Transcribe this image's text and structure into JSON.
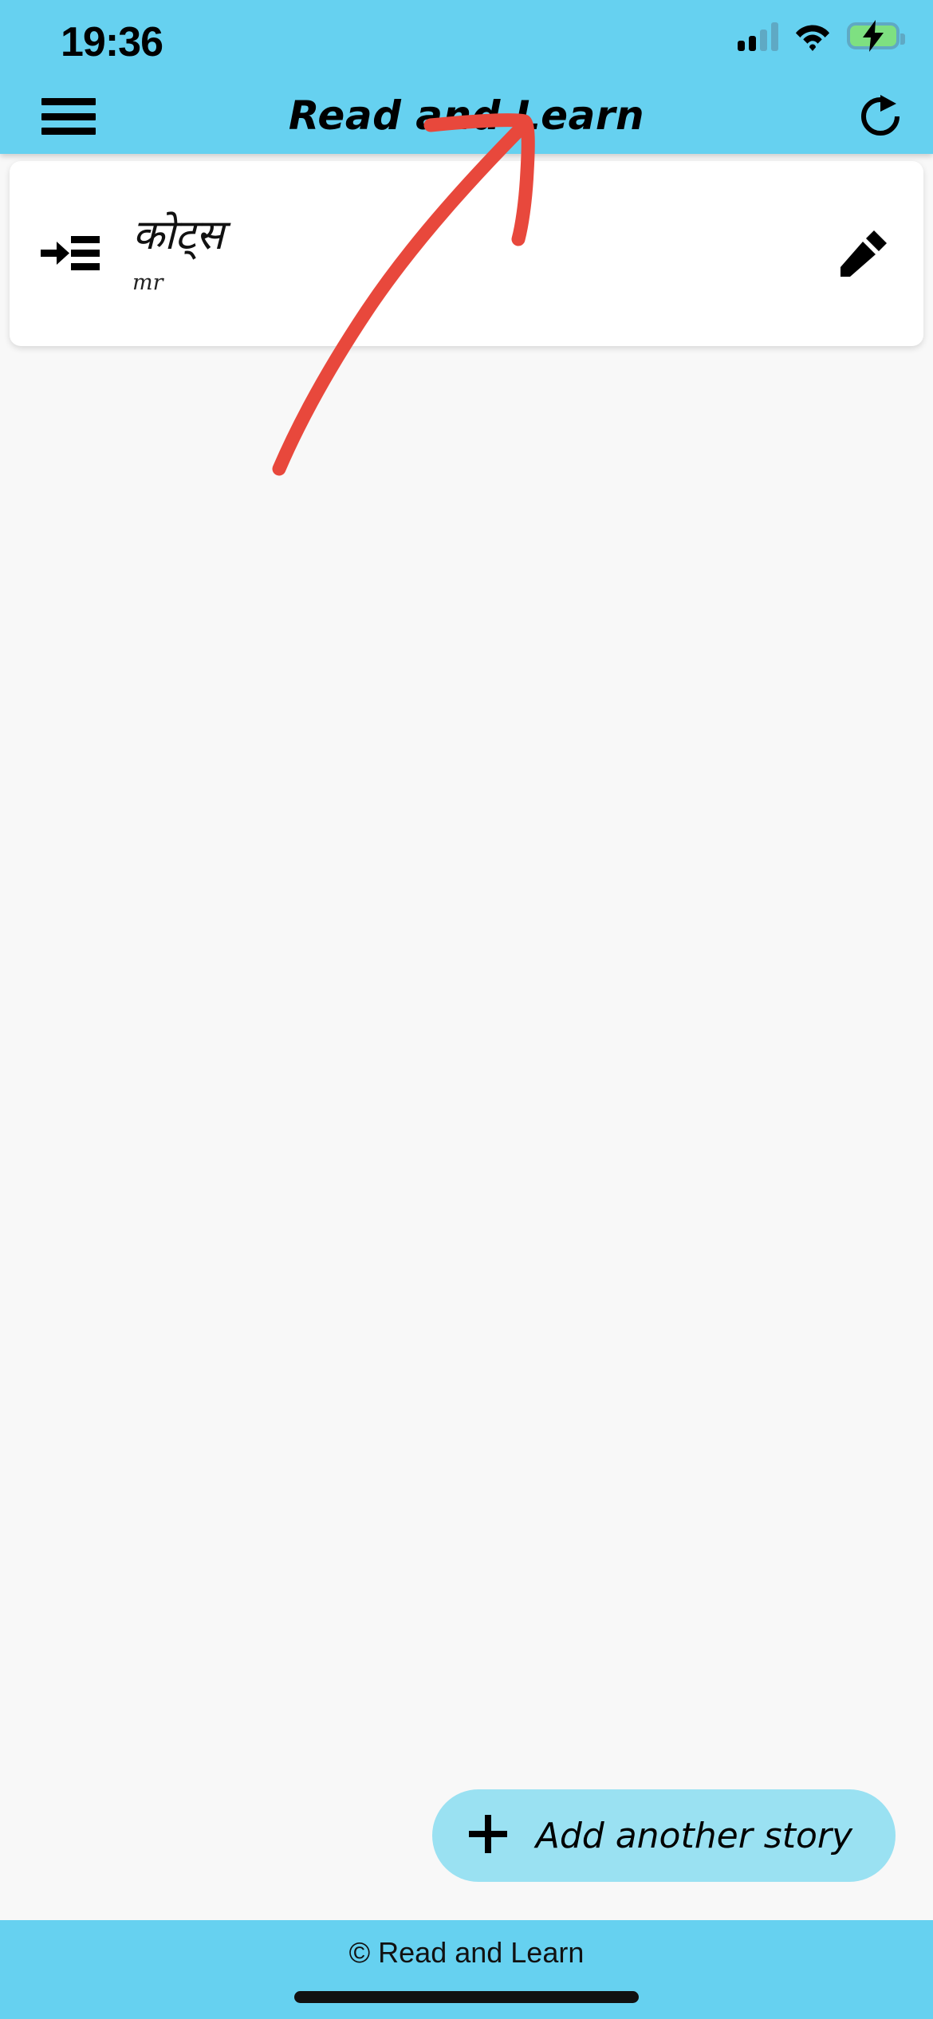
{
  "statusbar": {
    "time": "19:36",
    "signal_icon": "cellular-signal-icon",
    "wifi_icon": "wifi-icon",
    "battery_icon": "battery-charging-icon",
    "signal_bars_filled": 2,
    "signal_bars_total": 4
  },
  "appbar": {
    "menu_icon": "hamburger-menu-icon",
    "title": "Read and Learn",
    "refresh_icon": "refresh-icon"
  },
  "stories": [
    {
      "lead_icon": "arrow-into-list-icon",
      "title": "कोट्स",
      "subtitle": "mr",
      "edit_icon": "pencil-edit-icon"
    }
  ],
  "add_button": {
    "plus_icon": "plus-icon",
    "label": "Add another story"
  },
  "footer": {
    "copyright": "© Read and Learn",
    "home_indicator": "home-indicator"
  },
  "annotation": {
    "type": "hand-drawn-arrow",
    "color": "#e8483c",
    "points_to": "refresh-icon"
  },
  "colors": {
    "header_blue": "#66d1f0",
    "button_blue": "#9ae1f2",
    "page_background": "#f8f8f8",
    "card_white": "#ffffff",
    "annotation_red": "#e8483c",
    "battery_green": "#7ee081"
  }
}
